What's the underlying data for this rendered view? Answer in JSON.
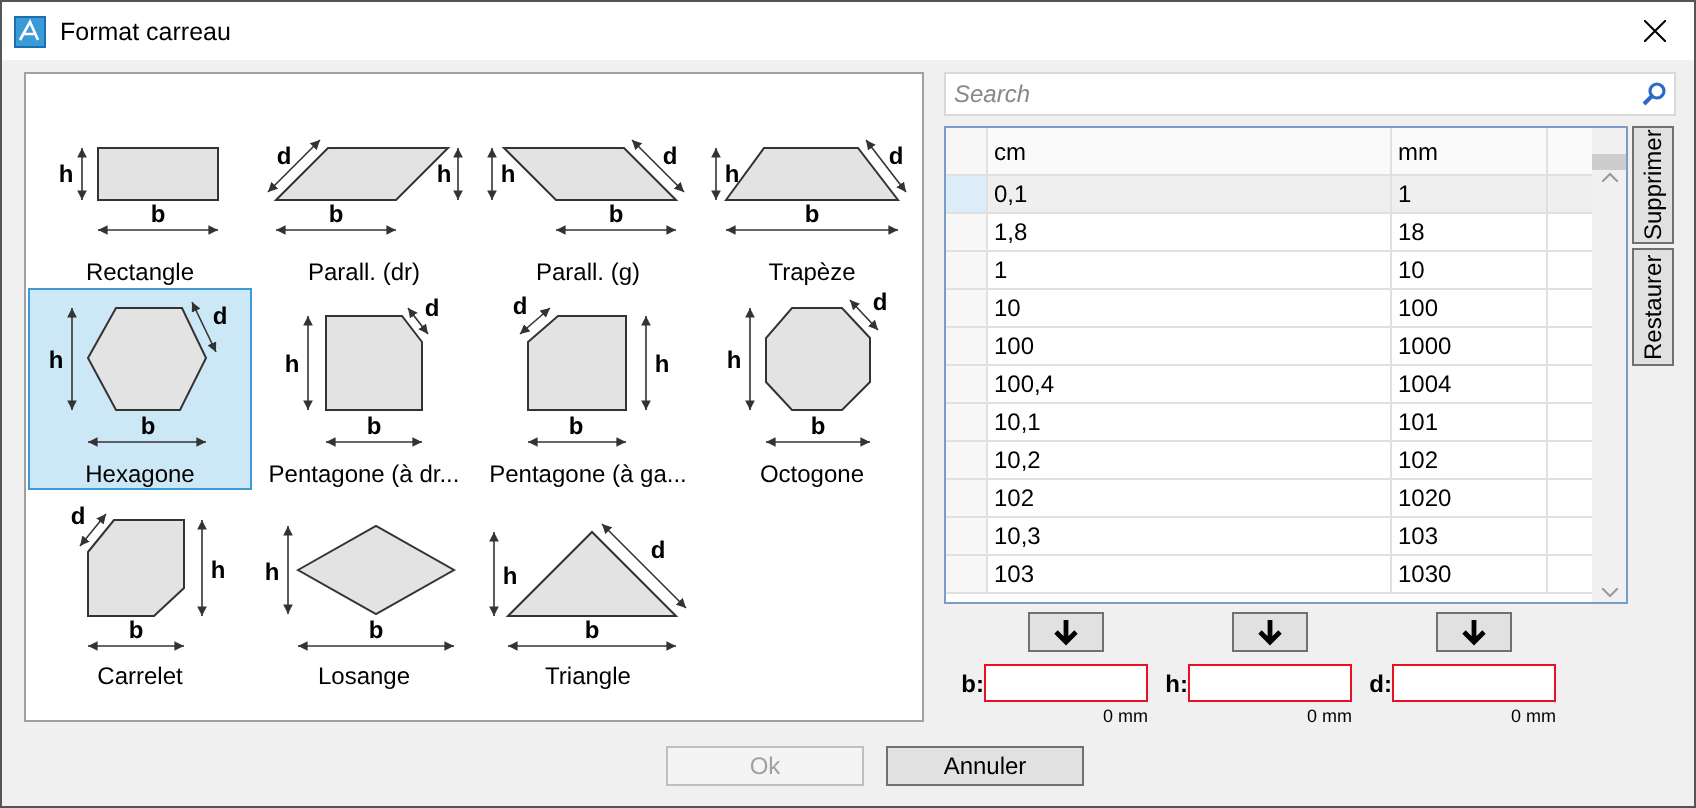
{
  "window": {
    "title": "Format carreau"
  },
  "tiles": [
    {
      "kind": "rectangle",
      "label": "Rectangle",
      "selected": false,
      "dims": [
        "h",
        "b"
      ]
    },
    {
      "kind": "parallel_right",
      "label": "Parall. (dr)",
      "selected": false,
      "dims": [
        "h",
        "b",
        "d"
      ]
    },
    {
      "kind": "parallel_left",
      "label": "Parall. (g)",
      "selected": false,
      "dims": [
        "h",
        "b",
        "d"
      ]
    },
    {
      "kind": "trapezoid",
      "label": "Trapèze",
      "selected": false,
      "dims": [
        "h",
        "b",
        "d"
      ]
    },
    {
      "kind": "hexagon",
      "label": "Hexagone",
      "selected": true,
      "dims": [
        "h",
        "b",
        "d"
      ]
    },
    {
      "kind": "pentagon_right",
      "label": "Pentagone (à dr...",
      "selected": false,
      "dims": [
        "h",
        "b",
        "d"
      ]
    },
    {
      "kind": "pentagon_left",
      "label": "Pentagone (à ga...",
      "selected": false,
      "dims": [
        "h",
        "b",
        "d"
      ]
    },
    {
      "kind": "octagon",
      "label": "Octogone",
      "selected": false,
      "dims": [
        "h",
        "b",
        "d"
      ]
    },
    {
      "kind": "carrelet",
      "label": "Carrelet",
      "selected": false,
      "dims": [
        "h",
        "b",
        "d"
      ]
    },
    {
      "kind": "rhombus",
      "label": "Losange",
      "selected": false,
      "dims": [
        "h",
        "b"
      ]
    },
    {
      "kind": "triangle",
      "label": "Triangle",
      "selected": false,
      "dims": [
        "h",
        "b",
        "d"
      ]
    }
  ],
  "search": {
    "placeholder": "Search"
  },
  "table": {
    "columns": [
      "cm",
      "mm"
    ],
    "rows": [
      {
        "cells": [
          "0,1",
          "1"
        ],
        "selected": true
      },
      {
        "cells": [
          "1,8",
          "18"
        ],
        "selected": false
      },
      {
        "cells": [
          "1",
          "10"
        ],
        "selected": false
      },
      {
        "cells": [
          "10",
          "100"
        ],
        "selected": false
      },
      {
        "cells": [
          "100",
          "1000"
        ],
        "selected": false
      },
      {
        "cells": [
          "100,4",
          "1004"
        ],
        "selected": false
      },
      {
        "cells": [
          "10,1",
          "101"
        ],
        "selected": false
      },
      {
        "cells": [
          "10,2",
          "102"
        ],
        "selected": false
      },
      {
        "cells": [
          "102",
          "1020"
        ],
        "selected": false
      },
      {
        "cells": [
          "10,3",
          "103"
        ],
        "selected": false
      },
      {
        "cells": [
          "103",
          "1030"
        ],
        "selected": false
      }
    ]
  },
  "side_buttons": [
    "Supprimer",
    "Restaurer"
  ],
  "fields": [
    {
      "label": "b:",
      "unit": "0 mm"
    },
    {
      "label": "h:",
      "unit": "0 mm"
    },
    {
      "label": "d:",
      "unit": "0 mm"
    }
  ],
  "buttons": [
    {
      "label": "Ok",
      "disabled": true
    },
    {
      "label": "Annuler",
      "disabled": false
    }
  ]
}
